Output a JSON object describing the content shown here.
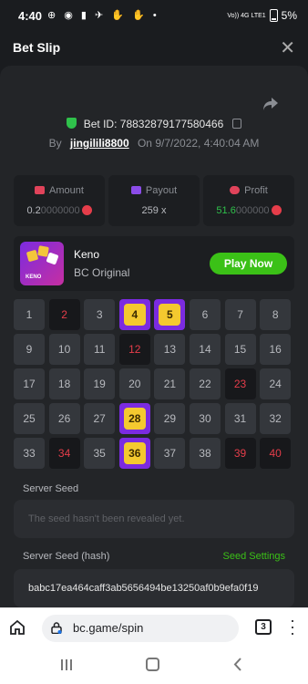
{
  "status_bar": {
    "time": "4:40",
    "icons": "⊕ ◉ ▮ ✈ ✋ ✋ •",
    "signal": "Vo)) 4G LTE1",
    "battery": "5%"
  },
  "header": {
    "title": "Bet Slip",
    "close_label": "✕"
  },
  "bet": {
    "id_label": "Bet ID:",
    "id_value": "78832879177580466",
    "by_label": "By",
    "user": "jingilili8800",
    "on_label": "On",
    "date": "9/7/2022, 4:40:04 AM"
  },
  "stats": {
    "amount_label": "Amount",
    "amount_main": "0.2",
    "amount_dim": "0000000",
    "payout_label": "Payout",
    "payout_value": "259 x",
    "profit_label": "Profit",
    "profit_main": "51.6",
    "profit_dim": "000000",
    "accent_green": "#3bc117",
    "coin_color": "#e53d4a"
  },
  "game": {
    "name": "Keno",
    "subtitle": "BC Original",
    "play_label": "Play Now",
    "thumb_text": "KENO"
  },
  "grid": [
    {
      "n": "1",
      "s": "normal"
    },
    {
      "n": "2",
      "s": "hit"
    },
    {
      "n": "3",
      "s": "normal"
    },
    {
      "n": "4",
      "s": "win"
    },
    {
      "n": "5",
      "s": "win"
    },
    {
      "n": "6",
      "s": "normal"
    },
    {
      "n": "7",
      "s": "normal"
    },
    {
      "n": "8",
      "s": "normal"
    },
    {
      "n": "9",
      "s": "normal"
    },
    {
      "n": "10",
      "s": "normal"
    },
    {
      "n": "11",
      "s": "normal"
    },
    {
      "n": "12",
      "s": "hit"
    },
    {
      "n": "13",
      "s": "normal"
    },
    {
      "n": "14",
      "s": "normal"
    },
    {
      "n": "15",
      "s": "normal"
    },
    {
      "n": "16",
      "s": "normal"
    },
    {
      "n": "17",
      "s": "normal"
    },
    {
      "n": "18",
      "s": "normal"
    },
    {
      "n": "19",
      "s": "normal"
    },
    {
      "n": "20",
      "s": "normal"
    },
    {
      "n": "21",
      "s": "normal"
    },
    {
      "n": "22",
      "s": "normal"
    },
    {
      "n": "23",
      "s": "hit"
    },
    {
      "n": "24",
      "s": "normal"
    },
    {
      "n": "25",
      "s": "normal"
    },
    {
      "n": "26",
      "s": "normal"
    },
    {
      "n": "27",
      "s": "normal"
    },
    {
      "n": "28",
      "s": "win"
    },
    {
      "n": "29",
      "s": "normal"
    },
    {
      "n": "30",
      "s": "normal"
    },
    {
      "n": "31",
      "s": "normal"
    },
    {
      "n": "32",
      "s": "normal"
    },
    {
      "n": "33",
      "s": "normal"
    },
    {
      "n": "34",
      "s": "hit"
    },
    {
      "n": "35",
      "s": "normal"
    },
    {
      "n": "36",
      "s": "win"
    },
    {
      "n": "37",
      "s": "normal"
    },
    {
      "n": "38",
      "s": "normal"
    },
    {
      "n": "39",
      "s": "hit"
    },
    {
      "n": "40",
      "s": "hit"
    }
  ],
  "seeds": {
    "server_seed_label": "Server Seed",
    "server_seed_placeholder": "The seed hasn't been revealed yet.",
    "hash_label": "Server Seed (hash)",
    "settings_label": "Seed Settings",
    "hash_value": "babc17ea464caff3ab5656494be13250af0b9efa0f19"
  },
  "browser": {
    "url": "bc.game/spin",
    "tab_count": "3"
  }
}
